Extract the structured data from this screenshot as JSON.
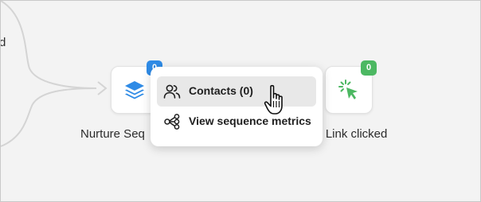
{
  "canvas": {
    "partial_label": "d",
    "background": "#f3f3f3"
  },
  "nodes": [
    {
      "name": "nurture-sequence",
      "label": "Nurture Seq",
      "badge": "0",
      "icon": "layers-icon",
      "badge_color": "#2f8be6"
    },
    {
      "name": "email-link-clicked",
      "label": "il Link clicked",
      "badge": "0",
      "icon": "cursor-click-icon",
      "badge_color": "#4cb862"
    }
  ],
  "context_menu": {
    "items": [
      {
        "label": "Contacts (0)",
        "icon": "users-icon"
      },
      {
        "label": "View sequence metrics",
        "icon": "share-nodes-icon"
      }
    ]
  }
}
